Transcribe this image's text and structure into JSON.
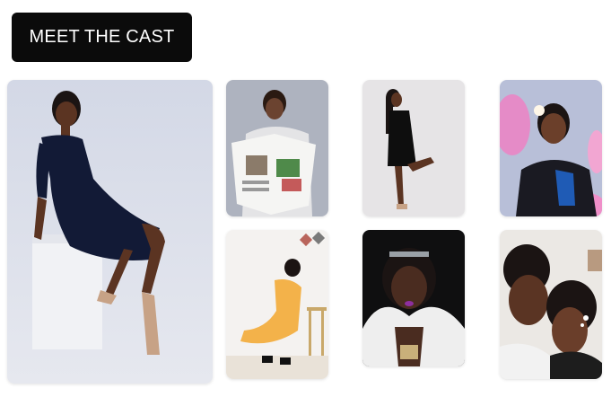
{
  "header": {
    "cta_label": "MEET THE CAST"
  },
  "gallery": {
    "photos": [
      {
        "alt": "cast-member-seated-on-white-cube"
      },
      {
        "alt": "cast-member-reading-newspaper"
      },
      {
        "alt": "cast-member-posing-black-dress"
      },
      {
        "alt": "cast-member-with-pink-flowers"
      },
      {
        "alt": "cast-member-in-yellow-dress-crouching"
      },
      {
        "alt": "cast-member-in-white-fur"
      },
      {
        "alt": "two-cast-members-portrait"
      }
    ]
  },
  "colors": {
    "button_bg": "#0b0b0b",
    "button_text": "#ffffff",
    "page_bg": "#ffffff"
  }
}
